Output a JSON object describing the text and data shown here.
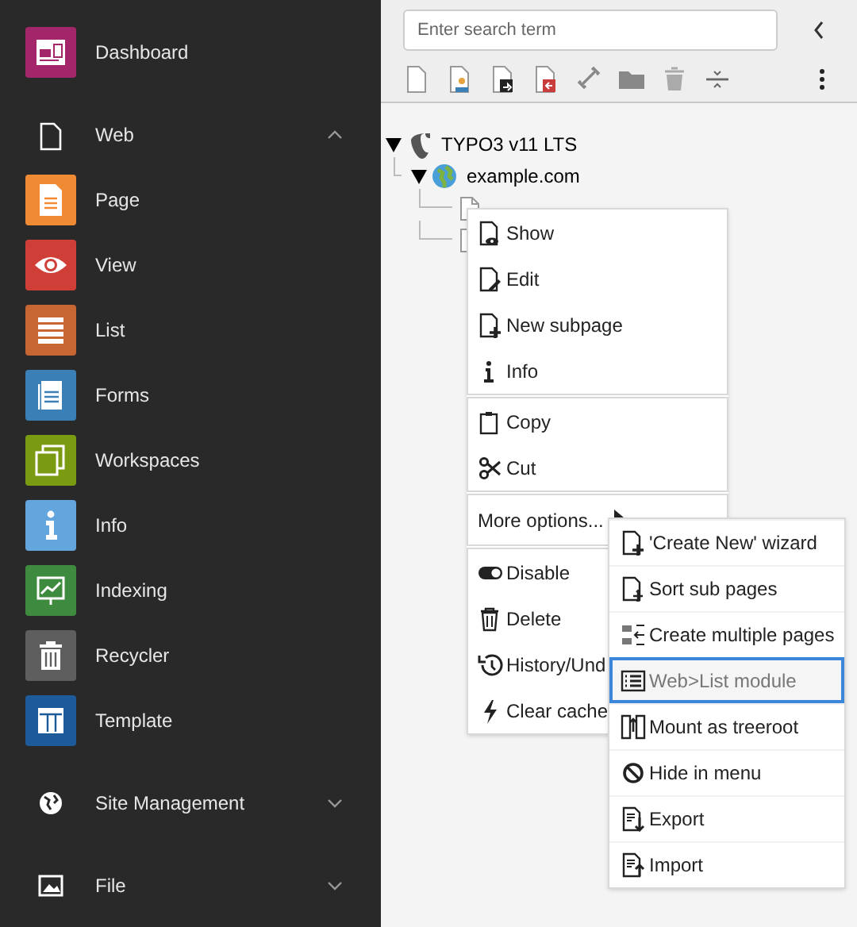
{
  "sidebar": {
    "dashboard": {
      "label": "Dashboard",
      "color": "#a3266a"
    },
    "groups": [
      {
        "label": "Web",
        "expanded": true,
        "modules": [
          {
            "label": "Page",
            "color": "#f08a34"
          },
          {
            "label": "View",
            "color": "#cf3f38"
          },
          {
            "label": "List",
            "color": "#c76632"
          },
          {
            "label": "Forms",
            "color": "#3a80b6"
          },
          {
            "label": "Workspaces",
            "color": "#7a9a12"
          },
          {
            "label": "Info",
            "color": "#62a6dd"
          },
          {
            "label": "Indexing",
            "color": "#3e8a3e"
          },
          {
            "label": "Recycler",
            "color": "#5e5e5e"
          },
          {
            "label": "Template",
            "color": "#1c5a99"
          }
        ]
      },
      {
        "label": "Site Management",
        "expanded": false
      },
      {
        "label": "File",
        "expanded": false
      }
    ]
  },
  "search": {
    "placeholder": "Enter search term"
  },
  "tree": [
    {
      "label": "TYPO3 v11 LTS",
      "kind": "root",
      "expanded": true,
      "children": [
        {
          "label": "example.com",
          "kind": "site",
          "expanded": true,
          "children": [
            {
              "kind": "page"
            },
            {
              "kind": "page"
            }
          ]
        }
      ]
    }
  ],
  "context_menu": {
    "groups": [
      [
        {
          "label": "Show"
        },
        {
          "label": "Edit"
        },
        {
          "label": "New subpage"
        },
        {
          "label": "Info"
        }
      ],
      [
        {
          "label": "Copy"
        },
        {
          "label": "Cut"
        }
      ],
      [
        {
          "label": "More options...",
          "kind": "submenu"
        }
      ],
      [
        {
          "label": "Disable"
        },
        {
          "label": "Delete"
        },
        {
          "label": "History/Und"
        },
        {
          "label": "Clear cache"
        }
      ]
    ],
    "submenu": [
      {
        "label": "'Create New' wizard",
        "selected": false
      },
      {
        "label": "Sort sub pages",
        "selected": false
      },
      {
        "label": "Create multiple pages",
        "selected": false
      },
      {
        "label": "Web>List module",
        "selected": true
      },
      {
        "label": "Mount as treeroot",
        "selected": false
      },
      {
        "label": "Hide in menu",
        "selected": false
      },
      {
        "label": "Export",
        "selected": false
      },
      {
        "label": "Import",
        "selected": false
      }
    ]
  }
}
